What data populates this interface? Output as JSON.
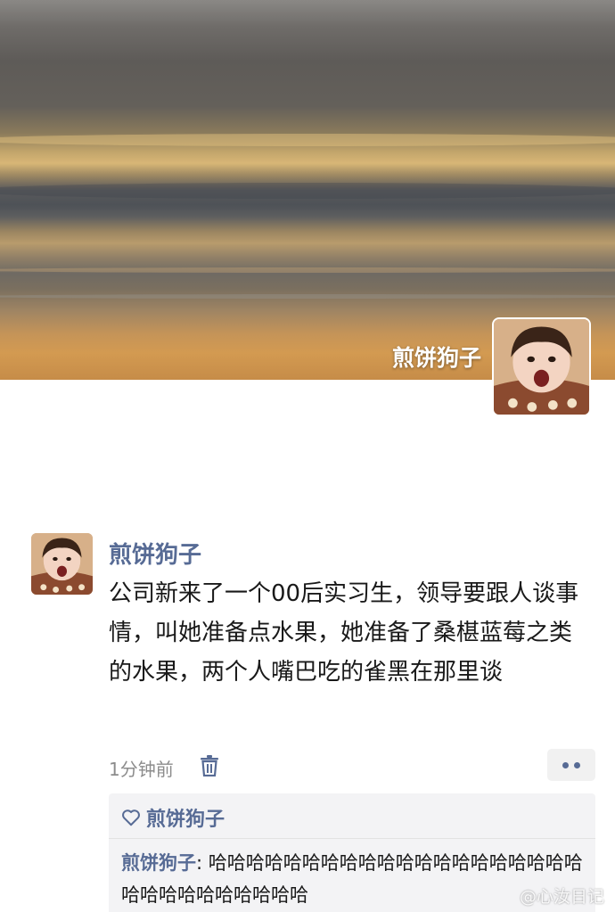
{
  "profile": {
    "cover_name": "煎饼狗子"
  },
  "post": {
    "author": "煎饼狗子",
    "text": "公司新来了一个00后实习生，领导要跟人谈事情，叫她准备点水果，她准备了桑椹蓝莓之类的水果，两个人嘴巴吃的雀黑在那里谈",
    "time": "1分钟前",
    "icons": {
      "delete": "trash-icon",
      "more": "more-dots-icon",
      "like": "heart-icon"
    }
  },
  "interactions": {
    "likes": "煎饼狗子",
    "comments": [
      {
        "author": "煎饼狗子",
        "separator": ": ",
        "text": "哈哈哈哈哈哈哈哈哈哈哈哈哈哈哈哈哈哈哈哈哈哈哈哈哈哈哈哈哈哈"
      }
    ]
  },
  "watermark": "@心汝日记"
}
